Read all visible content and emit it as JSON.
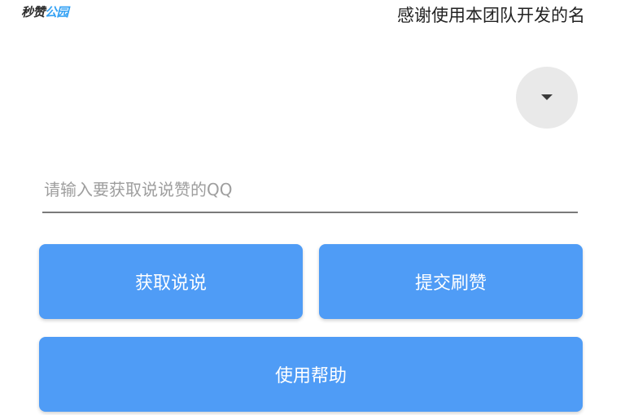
{
  "header": {
    "logo_part1": "秒赞",
    "logo_part2": "公园",
    "marquee_text": "感谢使用本团队开发的名"
  },
  "form": {
    "qq_placeholder": "请输入要获取说说赞的QQ",
    "qq_value": ""
  },
  "actions": {
    "fetch_label": "获取说说",
    "submit_label": "提交刷赞",
    "help_label": "使用帮助"
  },
  "icons": {
    "dropdown": "caret-down-icon"
  },
  "colors": {
    "button_primary": "#4f9cf6",
    "logo_accent": "#35a2f4",
    "dropdown_bg": "#e9e9e9"
  }
}
